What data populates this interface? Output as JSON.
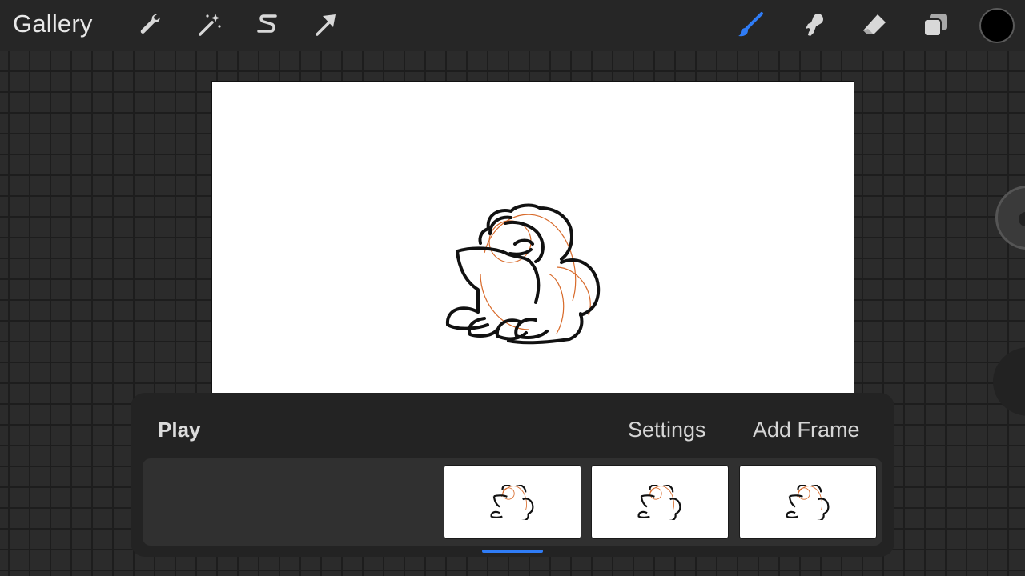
{
  "topbar": {
    "gallery_label": "Gallery",
    "tools_left": [
      "wrench-icon",
      "magic-wand-icon",
      "selection-s-icon",
      "transform-arrow-icon"
    ],
    "tools_right": [
      "brush-icon",
      "smudge-icon",
      "eraser-icon",
      "layers-icon"
    ],
    "active_tool": "brush-icon",
    "accent_color": "#2f7cf6",
    "current_color": "#000000"
  },
  "animation_panel": {
    "play_label": "Play",
    "settings_label": "Settings",
    "add_frame_label": "Add Frame",
    "frame_count": 3
  }
}
